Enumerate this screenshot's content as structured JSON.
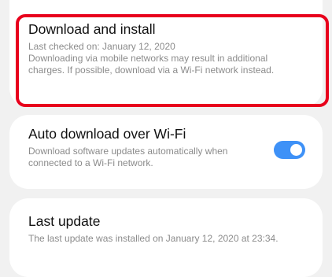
{
  "download_install": {
    "title": "Download and install",
    "last_checked": "Last checked on: January 12, 2020",
    "note": "Downloading via mobile networks may result in additional charges. If possible, download via a Wi-Fi network instead."
  },
  "auto_download": {
    "title": "Auto download over Wi-Fi",
    "description": "Download software updates automatically when connected to a Wi-Fi network.",
    "toggle_state": "on",
    "toggle_color": "#3e91f7"
  },
  "last_update": {
    "title": "Last update",
    "description": "The last update was installed on January 12, 2020 at 23:34."
  },
  "highlight_color": "#e8001c"
}
